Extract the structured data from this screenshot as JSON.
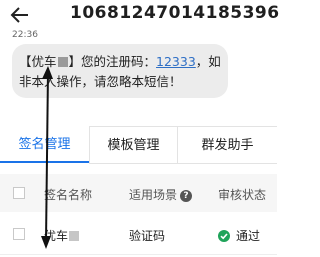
{
  "sms": {
    "sender_number": "10681247014185396",
    "time": "22:36",
    "message": {
      "brand_prefix": "【优车",
      "brand_suffix": "】您的注册码：",
      "code": "12333",
      "after_code": "，如",
      "line2": "非本人操作，请忽略本短信！"
    }
  },
  "tabs": [
    {
      "label": "签名管理",
      "active": true
    },
    {
      "label": "模板管理",
      "active": false
    },
    {
      "label": "群发助手",
      "active": false
    }
  ],
  "table": {
    "headers": {
      "name": "签名名称",
      "scene": "适用场景",
      "status": "审核状态"
    },
    "help_glyph": "?",
    "rows": [
      {
        "name": "优车",
        "scene": "验证码",
        "status": "通过"
      }
    ]
  },
  "colors": {
    "accent": "#1a73e8",
    "link": "#2f6fc5",
    "status_pass": "#1fa35a",
    "bubble": "#ececec"
  },
  "icons": [
    "back-arrow-icon",
    "help-icon",
    "check-circle-icon"
  ]
}
